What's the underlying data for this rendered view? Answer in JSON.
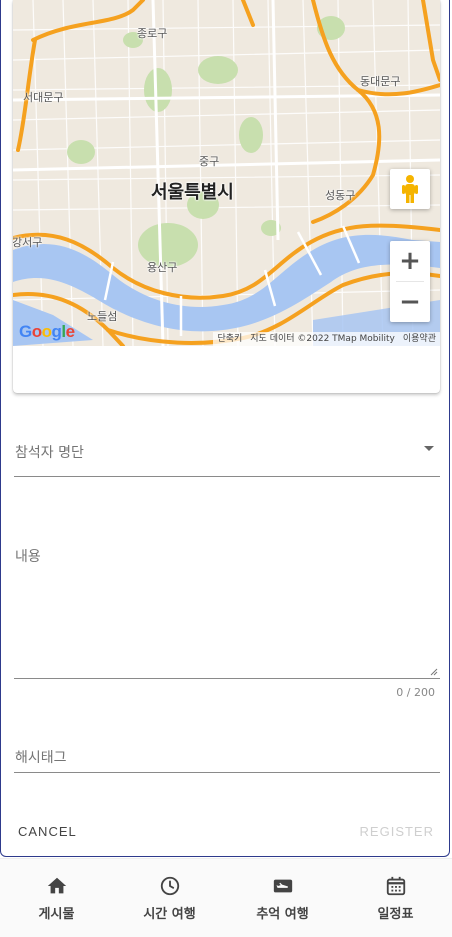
{
  "map": {
    "city_label": "서울특별시",
    "district_labels": [
      "종로구",
      "동대문구",
      "서대문구",
      "중구",
      "성동구",
      "용산구",
      "강서구",
      "노들섬"
    ],
    "google_logo": "Google",
    "attribution": {
      "shortcuts": "단축키",
      "data": "지도 데이터 ©2022 TMap Mobility",
      "terms": "이용약관"
    },
    "controls": {
      "zoom_in": "+",
      "zoom_out": "−"
    },
    "colors": {
      "land": "#efe9df",
      "park": "#c8dfae",
      "water": "#a8c6f2",
      "highway": "#f5a11f",
      "road": "#ffffff"
    }
  },
  "form": {
    "attendees_label": "참석자 명단",
    "content_label": "내용",
    "content_counter": "0 / 200",
    "hashtag_label": "해시태그"
  },
  "actions": {
    "cancel": "CANCEL",
    "register": "REGISTER"
  },
  "nav": {
    "items": [
      {
        "label": "게시물",
        "icon": "home-icon"
      },
      {
        "label": "시간 여행",
        "icon": "clock-icon"
      },
      {
        "label": "추억 여행",
        "icon": "ticket-icon"
      },
      {
        "label": "일정표",
        "icon": "calendar-icon"
      }
    ]
  }
}
